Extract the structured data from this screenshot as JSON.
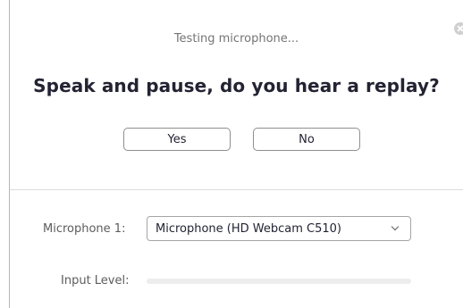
{
  "dialog": {
    "status_text": "Testing microphone...",
    "question": "Speak and pause, do you hear a replay?",
    "yes_label": "Yes",
    "no_label": "No",
    "close_icon": "close-icon"
  },
  "settings": {
    "microphone_label": "Microphone 1:",
    "microphone_selected": "Microphone (HD Webcam C510)",
    "input_level_label": "Input Level:",
    "input_level_value": 0
  },
  "colors": {
    "accent": "#2d8cff",
    "heading": "#232333",
    "muted": "#747474"
  }
}
